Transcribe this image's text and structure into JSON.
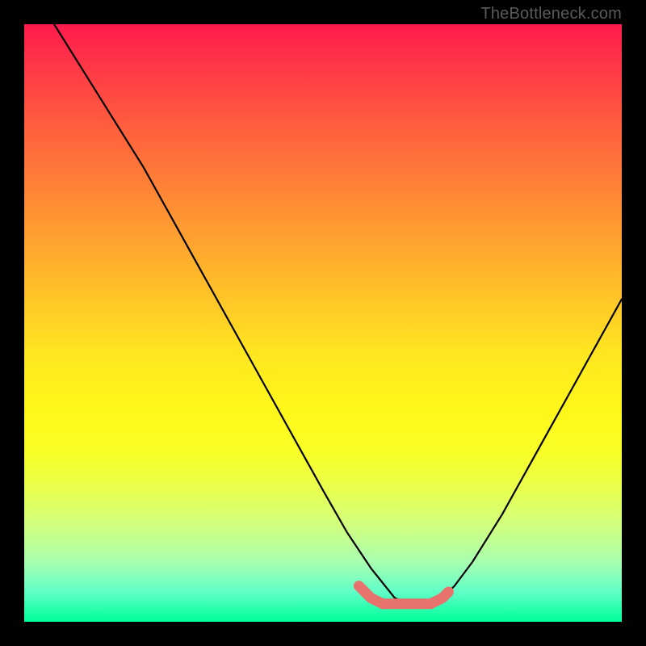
{
  "watermark": "TheBottleneck.com",
  "chart_data": {
    "type": "line",
    "title": "",
    "xlabel": "",
    "ylabel": "",
    "xlim": [
      0,
      100
    ],
    "ylim": [
      0,
      100
    ],
    "series": [
      {
        "name": "black-curve",
        "color": "#000000",
        "x": [
          5,
          10,
          15,
          20,
          25,
          30,
          35,
          40,
          45,
          50,
          54,
          58,
          62,
          64,
          66,
          68,
          70,
          72,
          75,
          80,
          85,
          90,
          95,
          100
        ],
        "y": [
          100,
          92,
          84,
          76,
          67,
          58,
          49,
          40,
          31,
          22,
          15,
          9,
          4,
          3,
          3,
          3,
          4,
          6,
          10,
          18,
          27,
          36,
          45,
          54
        ]
      },
      {
        "name": "coral-bottom-segment",
        "color": "#e8726c",
        "x": [
          56,
          58,
          60,
          62,
          64,
          66,
          68,
          70,
          71
        ],
        "y": [
          6,
          4,
          3,
          3,
          3,
          3,
          3,
          4,
          5
        ]
      }
    ]
  },
  "colors": {
    "background": "#000000",
    "gradient_top": "#ff1a4d",
    "gradient_bottom": "#00ff99",
    "curve": "#000000",
    "coral_segment": "#e8726c",
    "watermark": "#5a5a5a"
  }
}
